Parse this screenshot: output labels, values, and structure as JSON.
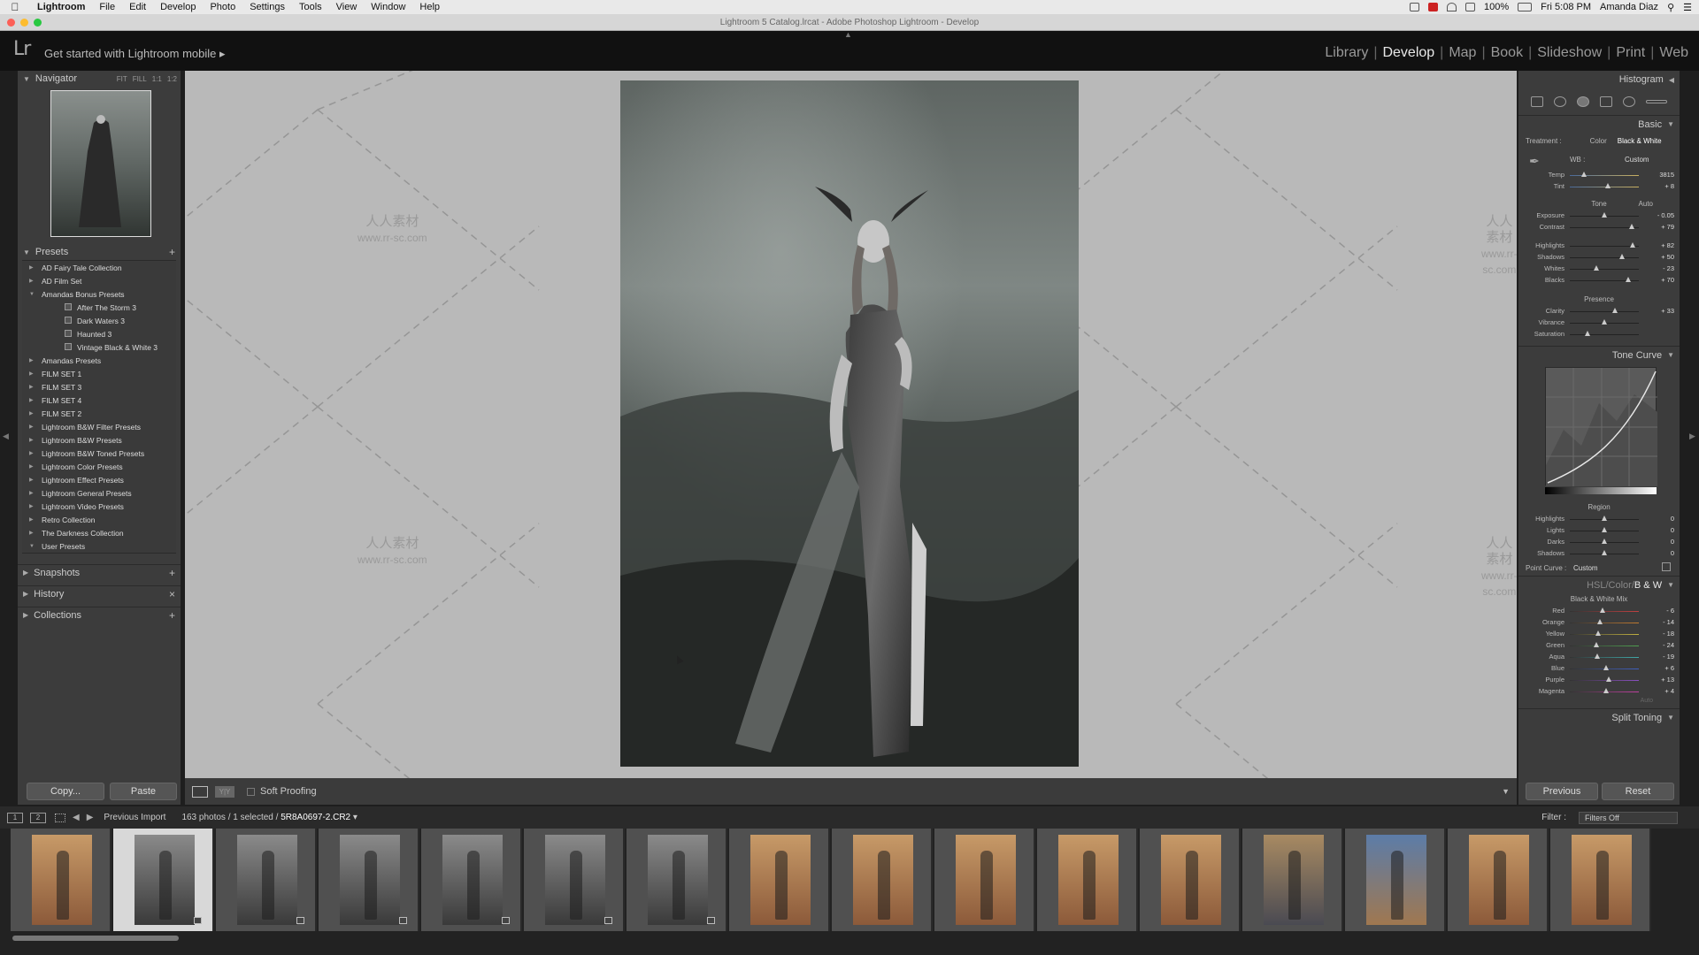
{
  "menubar": {
    "app": "Lightroom",
    "items": [
      "File",
      "Edit",
      "Develop",
      "Photo",
      "Settings",
      "Tools",
      "View",
      "Window",
      "Help"
    ],
    "battery": "100%",
    "clock": "Fri 5:08 PM",
    "user": "Amanda Diaz"
  },
  "window": {
    "title": "Lightroom 5 Catalog.lrcat - Adobe Photoshop Lightroom - Develop"
  },
  "identity": {
    "logo": "Lr",
    "mobile": "Get started with Lightroom mobile"
  },
  "modules": [
    "Library",
    "Develop",
    "Map",
    "Book",
    "Slideshow",
    "Print",
    "Web"
  ],
  "modules_active": "Develop",
  "left": {
    "navigator": {
      "title": "Navigator",
      "zoom": [
        "FIT",
        "FILL",
        "1:1",
        "1:2"
      ]
    },
    "presets": {
      "title": "Presets",
      "items": [
        {
          "label": "AD Fairy Tale Collection",
          "level": 0,
          "open": false
        },
        {
          "label": "AD Film Set",
          "level": 0,
          "open": false
        },
        {
          "label": "Amandas Bonus Presets",
          "level": 0,
          "open": true
        },
        {
          "label": "After The Storm 3",
          "level": 1
        },
        {
          "label": "Dark Waters 3",
          "level": 1
        },
        {
          "label": "Haunted 3",
          "level": 1
        },
        {
          "label": "Vintage Black & White 3",
          "level": 1
        },
        {
          "label": "Amandas Presets",
          "level": 0,
          "open": false
        },
        {
          "label": "FILM SET 1",
          "level": 0,
          "open": false
        },
        {
          "label": "FILM SET 3",
          "level": 0,
          "open": false
        },
        {
          "label": "FILM SET 4",
          "level": 0,
          "open": false
        },
        {
          "label": "FILM SET 2",
          "level": 0,
          "open": false
        },
        {
          "label": "Lightroom B&W Filter Presets",
          "level": 0,
          "open": false
        },
        {
          "label": "Lightroom B&W Presets",
          "level": 0,
          "open": false
        },
        {
          "label": "Lightroom B&W Toned Presets",
          "level": 0,
          "open": false
        },
        {
          "label": "Lightroom Color Presets",
          "level": 0,
          "open": false
        },
        {
          "label": "Lightroom Effect Presets",
          "level": 0,
          "open": false
        },
        {
          "label": "Lightroom General Presets",
          "level": 0,
          "open": false
        },
        {
          "label": "Lightroom Video Presets",
          "level": 0,
          "open": false
        },
        {
          "label": "Retro Collection",
          "level": 0,
          "open": false
        },
        {
          "label": "The Darkness Collection",
          "level": 0,
          "open": false
        },
        {
          "label": "User Presets",
          "level": 0,
          "open": true
        }
      ]
    },
    "snapshots": "Snapshots",
    "history": "History",
    "collections": "Collections",
    "copy": "Copy...",
    "paste": "Paste"
  },
  "toolbar": {
    "soft_proofing": "Soft Proofing",
    "view_secondary": "Y|Y"
  },
  "watermark": {
    "cn": "人人素材",
    "url": "www.rr-sc.com"
  },
  "right": {
    "histogram": "Histogram",
    "basic": {
      "title": "Basic",
      "treatment_label": "Treatment :",
      "treatment_color": "Color",
      "treatment_bw": "Black & White",
      "wb_label": "WB :",
      "wb_value": "Custom",
      "wb_sliders": [
        {
          "label": "Temp",
          "value": "3815",
          "pos": 0.2
        },
        {
          "label": "Tint",
          "value": "+ 8",
          "pos": 0.55
        }
      ],
      "tone_label": "Tone",
      "tone_auto": "Auto",
      "tone_sliders": [
        {
          "label": "Exposure",
          "value": "- 0.05",
          "pos": 0.5
        },
        {
          "label": "Contrast",
          "value": "+ 79",
          "pos": 0.9
        }
      ],
      "tone_sliders2": [
        {
          "label": "Highlights",
          "value": "+ 82",
          "pos": 0.91
        },
        {
          "label": "Shadows",
          "value": "+ 50",
          "pos": 0.75
        },
        {
          "label": "Whites",
          "value": "- 23",
          "pos": 0.38
        },
        {
          "label": "Blacks",
          "value": "+ 70",
          "pos": 0.85
        }
      ],
      "presence_label": "Presence",
      "presence_sliders": [
        {
          "label": "Clarity",
          "value": "+ 33",
          "pos": 0.66
        },
        {
          "label": "Vibrance",
          "value": "",
          "pos": 0.5
        },
        {
          "label": "Saturation",
          "value": "",
          "pos": 0.25
        }
      ]
    },
    "tone_curve": {
      "title": "Tone Curve",
      "region_label": "Region",
      "region_sliders": [
        {
          "label": "Highlights",
          "value": "0",
          "pos": 0.5
        },
        {
          "label": "Lights",
          "value": "0",
          "pos": 0.5
        },
        {
          "label": "Darks",
          "value": "0",
          "pos": 0.5
        },
        {
          "label": "Shadows",
          "value": "0",
          "pos": 0.5
        }
      ],
      "point_curve_label": "Point Curve :",
      "point_curve_value": "Custom"
    },
    "hsl": {
      "tabs": [
        "HSL",
        "Color",
        "B & W"
      ],
      "active": "B & W",
      "mix_label": "Black & White Mix",
      "auto": "Auto",
      "sliders": [
        {
          "label": "Red",
          "value": "- 6",
          "pos": 0.47
        },
        {
          "label": "Orange",
          "value": "- 14",
          "pos": 0.43
        },
        {
          "label": "Yellow",
          "value": "- 18",
          "pos": 0.41
        },
        {
          "label": "Green",
          "value": "- 24",
          "pos": 0.38
        },
        {
          "label": "Aqua",
          "value": "- 19",
          "pos": 0.4
        },
        {
          "label": "Blue",
          "value": "+ 6",
          "pos": 0.53
        },
        {
          "label": "Purple",
          "value": "+ 13",
          "pos": 0.57
        },
        {
          "label": "Magenta",
          "value": "+ 4",
          "pos": 0.52
        }
      ]
    },
    "split_toning": "Split Toning",
    "previous": "Previous",
    "reset": "Reset"
  },
  "filmstrip": {
    "view1": "1",
    "view2": "2",
    "source": "Previous Import",
    "count": "163 photos / 1 selected /",
    "filename": "5R8A0697-2.CR2",
    "filter_label": "Filter :",
    "filter_value": "Filters Off",
    "thumbs": [
      {
        "tone": "warm",
        "selected": false,
        "badge": false
      },
      {
        "tone": "bw",
        "selected": true,
        "badge": true
      },
      {
        "tone": "bw",
        "selected": false,
        "badge": true
      },
      {
        "tone": "bw",
        "selected": false,
        "badge": true
      },
      {
        "tone": "bw",
        "selected": false,
        "badge": true
      },
      {
        "tone": "bw",
        "selected": false,
        "badge": true
      },
      {
        "tone": "bw",
        "selected": false,
        "badge": true
      },
      {
        "tone": "warm",
        "selected": false,
        "badge": false
      },
      {
        "tone": "warm",
        "selected": false,
        "badge": false
      },
      {
        "tone": "warm",
        "selected": false,
        "badge": false
      },
      {
        "tone": "warm",
        "selected": false,
        "badge": false
      },
      {
        "tone": "warm",
        "selected": false,
        "badge": false
      },
      {
        "tone": "mixed",
        "selected": false,
        "badge": false
      },
      {
        "tone": "blue",
        "selected": false,
        "badge": false
      },
      {
        "tone": "warm",
        "selected": false,
        "badge": false
      },
      {
        "tone": "warm",
        "selected": false,
        "badge": false
      }
    ]
  },
  "colors": {
    "accent_active": "#e8e8e8",
    "panel": "#3c3c3c",
    "canvas": "#b9b9b9",
    "thumb_warm": "#b98a5c",
    "thumb_bw": "#6a6a6a",
    "thumb_blue": "#4d6a96"
  }
}
